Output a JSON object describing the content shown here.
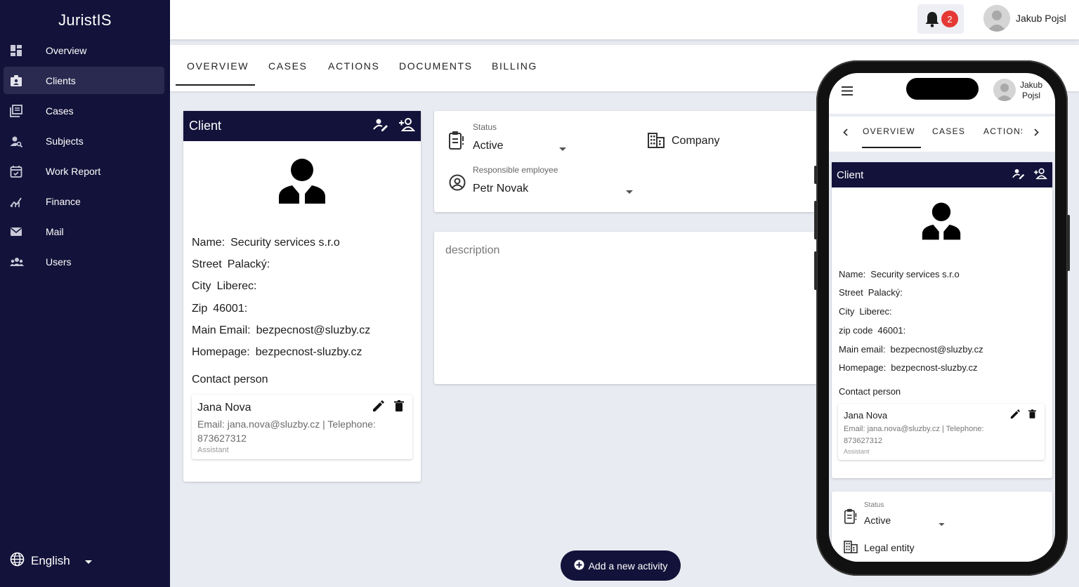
{
  "app": {
    "title": "JuristIS"
  },
  "sidebar": {
    "items": [
      {
        "label": "Overview",
        "icon": "dashboard-icon"
      },
      {
        "label": "Clients",
        "icon": "badge-icon",
        "active": true
      },
      {
        "label": "Cases",
        "icon": "library-icon"
      },
      {
        "label": "Subjects",
        "icon": "person-search-icon"
      },
      {
        "label": "Work Report",
        "icon": "calendar-check-icon"
      },
      {
        "label": "Finance",
        "icon": "chart-icon"
      },
      {
        "label": "Mail",
        "icon": "mail-icon"
      },
      {
        "label": "Users",
        "icon": "users-icon"
      }
    ],
    "language": "English"
  },
  "header": {
    "notifications": "2",
    "user_name": "Jakub Pojsl"
  },
  "tabs": [
    "OVERVIEW",
    "CASES",
    "ACTIONS",
    "DOCUMENTS",
    "BILLING"
  ],
  "client": {
    "title": "Client",
    "rows": [
      {
        "label": "Name:",
        "value": "Security services s.r.o"
      },
      {
        "label": "Street",
        "value": "Palacký:"
      },
      {
        "label": "City",
        "value": "Liberec:"
      },
      {
        "label": "Zip",
        "value": "46001:"
      },
      {
        "label": "Main Email:",
        "value": "bezpecnost@sluzby.cz"
      },
      {
        "label": "Homepage:",
        "value": "bezpecnost-sluzby.cz"
      }
    ],
    "contact_heading": "Contact person",
    "contact": {
      "name": "Jana Nova",
      "details": "Email: jana.nova@sluzby.cz | Telephone: 873627312",
      "role": "Assistant"
    }
  },
  "status_card": {
    "status_label": "Status",
    "status_value": "Active",
    "entity_type": "Company",
    "employee_label": "Responsible employee",
    "employee_value": "Petr Novak"
  },
  "description": {
    "placeholder": "description"
  },
  "fab": {
    "label": "Add a new activity"
  },
  "mobile": {
    "user_name_line1": "Jakub",
    "user_name_line2": "Pojsl",
    "tabs": [
      "OVERVIEW",
      "CASES",
      "ACTIONS"
    ],
    "client_title": "Client",
    "rows": [
      {
        "label": "Name:",
        "value": "Security services s.r.o"
      },
      {
        "label": "Street",
        "value": "Palacký:"
      },
      {
        "label": "City",
        "value": "Liberec:"
      },
      {
        "label": "zip code",
        "value": "46001:"
      },
      {
        "label": "Main email:",
        "value": "bezpecnost@sluzby.cz"
      },
      {
        "label": "Homepage:",
        "value": "bezpecnost-sluzby.cz"
      }
    ],
    "contact_heading": "Contact person",
    "contact": {
      "name": "Jana Nova",
      "details": "Email: jana.nova@sluzby.cz | Telephone: 873627312",
      "role": "Assistant"
    },
    "status_label": "Status",
    "status_value": "Active",
    "entity_type": "Legal entity"
  },
  "colors": {
    "sidebar": "#13123a",
    "active_item": "#2a2950",
    "page_bg": "#e9ebf2",
    "badge": "#e53935"
  }
}
